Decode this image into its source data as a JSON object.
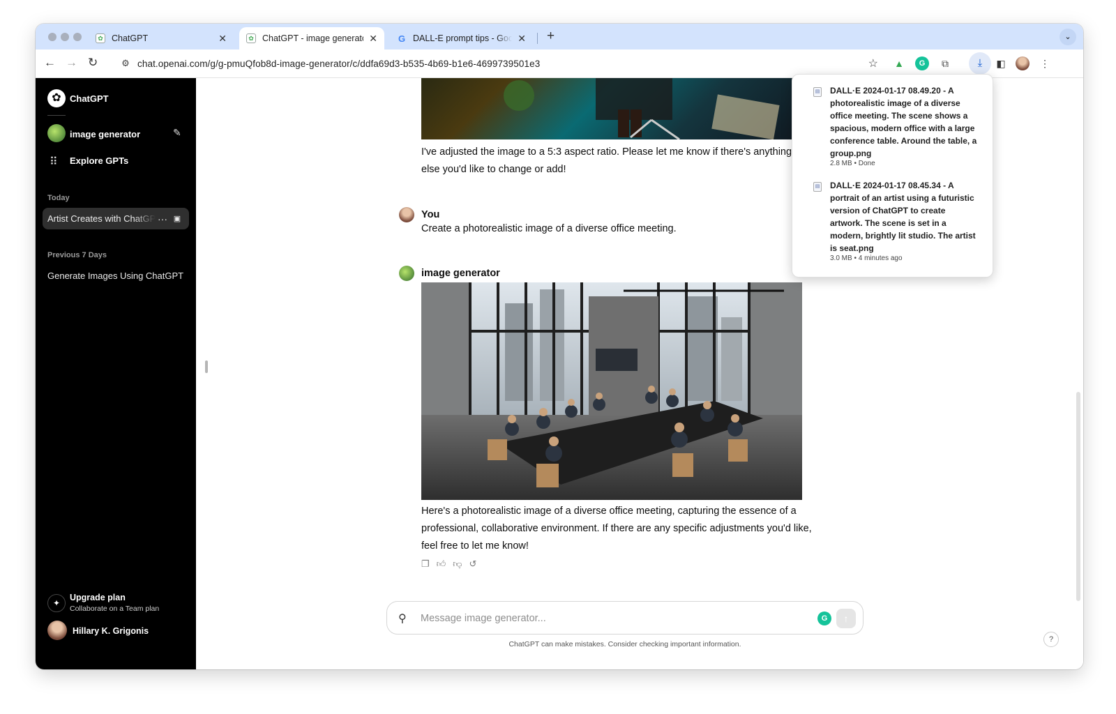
{
  "browser": {
    "tabs": [
      {
        "title": "ChatGPT",
        "close": "✕",
        "icon": "chatgpt-icon"
      },
      {
        "title": "ChatGPT - image generator",
        "close": "✕",
        "icon": "chatgpt-icon"
      },
      {
        "title": "DALL-E prompt tips - Google",
        "close": "✕",
        "icon": "google-icon"
      }
    ],
    "new_tab": "+",
    "url": "chat.openai.com/g/g-pmuQfob8d-image-generator/c/ddfa69d3-b535-4b69-b1e6-4699739501e3"
  },
  "downloads": [
    {
      "name": "DALL·E 2024-01-17 08.49.20 - A photorealistic image of a diverse office meeting. The scene shows a spacious, modern office with a large conference table. Around the table, a group.png",
      "meta": "2.8 MB • Done"
    },
    {
      "name": "DALL·E 2024-01-17 08.45.34 - A portrait of an artist using a futuristic version of ChatGPT to create artwork. The scene is set in a modern, brightly lit studio. The artist is seat.png",
      "meta": "3.0 MB • 4 minutes ago"
    }
  ],
  "sidebar": {
    "brand": "ChatGPT",
    "gpt_name": "image generator",
    "explore": "Explore GPTs",
    "sections": [
      {
        "label": "Today",
        "items": [
          {
            "label": "Artist Creates with ChatGPT",
            "dots": "···"
          }
        ]
      },
      {
        "label": "Previous 7 Days",
        "items": [
          {
            "label": "Generate Images Using ChatGPT"
          }
        ]
      }
    ],
    "upgrade_title": "Upgrade plan",
    "upgrade_sub": "Collaborate on a Team plan",
    "user_name": "Hillary K. Grigonis"
  },
  "chat": {
    "messages": [
      {
        "role": "assistant",
        "text": "I've adjusted the image to a 5:3 aspect ratio. Please let me know if there's anything else you'd like to change or add!"
      },
      {
        "role": "user",
        "name": "You",
        "text": "Create a photorealistic image of a diverse office meeting."
      },
      {
        "role": "assistant",
        "name": "image generator",
        "text": "Here's a photorealistic image of a diverse office meeting, capturing the essence of a professional, collaborative environment. If there are any specific adjustments you'd like, feel free to let me know!"
      }
    ],
    "composer_placeholder": "Message image generator...",
    "disclaimer": "ChatGPT can make mistakes. Consider checking important information.",
    "help": "?"
  },
  "colors": {
    "sidebar_bg": "#000000",
    "tabstrip": "#d3e3fd",
    "grammarly": "#15c39a"
  }
}
